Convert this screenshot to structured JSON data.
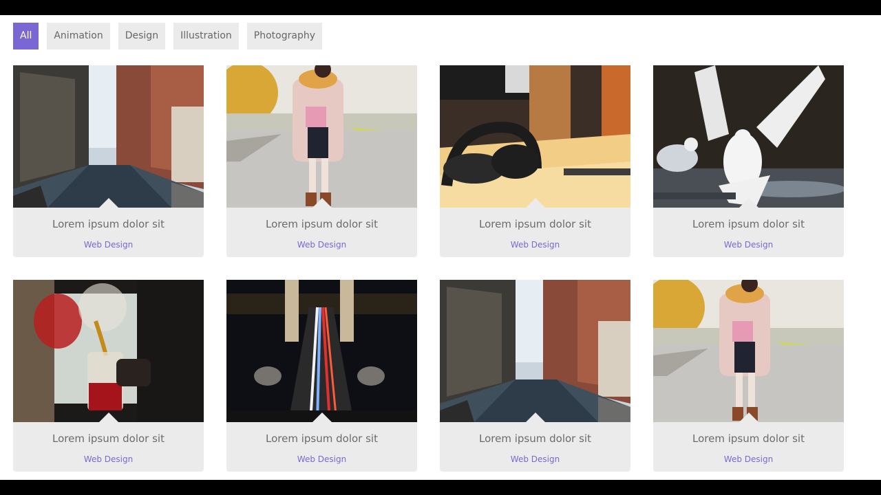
{
  "filters": [
    {
      "label": "All",
      "active": true
    },
    {
      "label": "Animation",
      "active": false
    },
    {
      "label": "Design",
      "active": false
    },
    {
      "label": "Illustration",
      "active": false
    },
    {
      "label": "Photography",
      "active": false
    }
  ],
  "cards": [
    {
      "title": "Lorem ipsum dolor sit",
      "category": "Web Design",
      "image": "city-street-photo"
    },
    {
      "title": "Lorem ipsum dolor sit",
      "category": "Web Design",
      "image": "woman-autumn-road-photo"
    },
    {
      "title": "Lorem ipsum dolor sit",
      "category": "Web Design",
      "image": "headphones-desk-photo"
    },
    {
      "title": "Lorem ipsum dolor sit",
      "category": "Web Design",
      "image": "seagulls-photo"
    },
    {
      "title": "Lorem ipsum dolor sit",
      "category": "Web Design",
      "image": "pouring-tea-jar-photo"
    },
    {
      "title": "Lorem ipsum dolor sit",
      "category": "Web Design",
      "image": "night-bridge-traffic-photo"
    },
    {
      "title": "Lorem ipsum dolor sit",
      "category": "Web Design",
      "image": "city-street-photo"
    },
    {
      "title": "Lorem ipsum dolor sit",
      "category": "Web Design",
      "image": "woman-autumn-road-photo"
    }
  ],
  "colors": {
    "accent": "#7b67d3",
    "filter_bg": "#ebebeb",
    "card_bg": "#ebebeb",
    "title_text": "#6b6b6b"
  }
}
